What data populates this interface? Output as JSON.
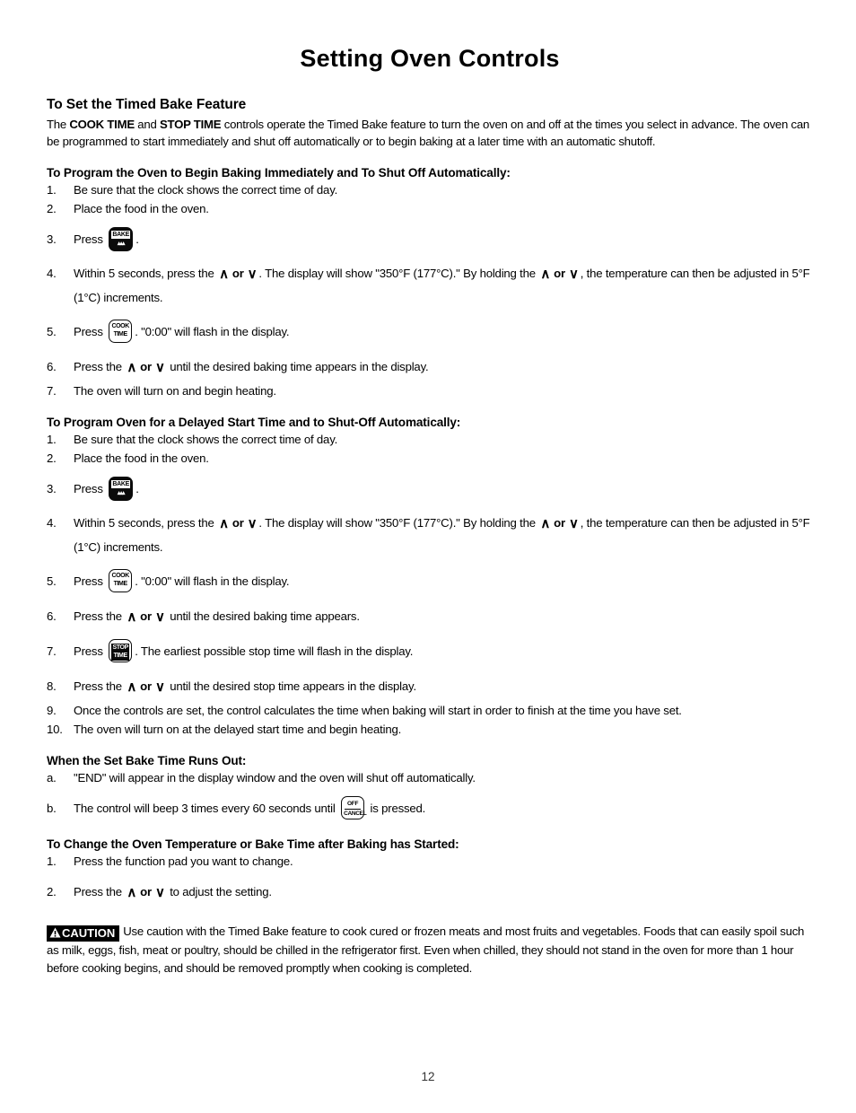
{
  "page": {
    "title": "Setting Oven Controls",
    "folio": "12"
  },
  "section_main": {
    "heading": "To Set the Timed Bake Feature",
    "intro_pre": "The ",
    "intro_b1": "COOK TIME",
    "intro_mid": " and ",
    "intro_b2": "STOP TIME",
    "intro_post": " controls operate the Timed Bake feature to turn the oven on and off at the times you select in advance. The oven can be programmed to start immediately and shut off automatically or to begin baking at a later time with an automatic shutoff."
  },
  "section_immediate": {
    "heading": "To Program the Oven to Begin Baking Immediately and To Shut Off Automatically:",
    "steps": [
      {
        "num": "1.",
        "text": "Be sure that the clock shows the correct time of day."
      },
      {
        "num": "2.",
        "text": "Place the food in the oven."
      },
      {
        "num": "3.",
        "pre": "Press ",
        "pad": "bake",
        "post": "."
      },
      {
        "num": "4.",
        "pre": "Within 5 seconds, press the ",
        "mid": ". The display will show \"350°F (177°C).\" By holding the ",
        "post": ", the temperature can then be adjusted in 5°F (1°C) increments."
      },
      {
        "num": "5.",
        "pre": "Press ",
        "pad": "cook-time",
        "post": ". \"0:00\" will flash in the display."
      },
      {
        "num": "6.",
        "pre": "Press the ",
        "post": " until the desired baking time appears in the display."
      },
      {
        "num": "7.",
        "text": "The oven will turn on and begin heating."
      }
    ]
  },
  "section_delayed": {
    "heading": "To Program Oven for a Delayed Start Time and to Shut-Off Automatically:",
    "steps": [
      {
        "num": "1.",
        "text": "Be sure that the clock shows the correct time of day."
      },
      {
        "num": "2.",
        "text": "Place the food in the oven."
      },
      {
        "num": "3.",
        "pre": "Press ",
        "pad": "bake",
        "post": "."
      },
      {
        "num": "4.",
        "pre": "Within 5 seconds, press the ",
        "mid": ". The display will show \"350°F (177°C).\" By holding the ",
        "post": ", the temperature can then be adjusted in 5°F (1°C) increments."
      },
      {
        "num": "5.",
        "pre": "Press ",
        "pad": "cook-time",
        "post": ". \"0:00\" will flash in the display."
      },
      {
        "num": "6.",
        "pre": "Press the ",
        "post": " until the desired baking time appears."
      },
      {
        "num": "7.",
        "pre": "Press ",
        "pad": "stop-time",
        "post": ". The earliest possible stop time will flash in the display."
      },
      {
        "num": "8.",
        "pre": "Press the ",
        "post": " until the desired stop time appears in the display."
      },
      {
        "num": "9.",
        "text": "Once the controls are set, the control calculates the time when baking will start in order to finish at the time you have set."
      },
      {
        "num": "10.",
        "text": "The oven will turn on at the delayed start time and begin heating."
      }
    ]
  },
  "section_runsout": {
    "heading": "When the Set Bake Time Runs Out:",
    "steps": [
      {
        "num": "a.",
        "text": "\"END\" will appear in the display window and the oven will shut off automatically."
      },
      {
        "num": "b.",
        "pre": "The control will beep 3 times every 60 seconds until ",
        "pad": "off-cancel",
        "post": " is pressed."
      }
    ]
  },
  "section_change": {
    "heading": "To Change the Oven Temperature or Bake Time after Baking has Started:",
    "steps": [
      {
        "num": "1.",
        "text": "Press the function pad you want to change."
      },
      {
        "num": "2.",
        "pre": "Press the ",
        "post": " to adjust the setting."
      }
    ]
  },
  "caution": {
    "badge_label": "CAUTION",
    "text": "Use caution with the Timed Bake feature to cook cured or frozen meats and most fruits and vegetables. Foods that can easily spoil such as milk, eggs, fish, meat or poultry, should be chilled in the refrigerator first. Even when chilled, they should not stand in the oven for more than 1 hour before cooking begins, and should be removed promptly when cooking is completed."
  },
  "glyphs": {
    "chevron_up": "∧",
    "chevron_down": "∨",
    "or": "or",
    "bake_label": "BAKE",
    "bake_coil": "▴▴▴",
    "cook_line1": "COOK",
    "cook_line2": "TIME",
    "stop_line1": "STOP",
    "stop_line2": "TIME",
    "off_line1": "OFF",
    "off_line2": "CANCEL",
    "warning_triangle": "⚠"
  },
  "colors": {
    "ink": "#000000",
    "paper": "#ffffff",
    "caution_bg": "#000000"
  }
}
